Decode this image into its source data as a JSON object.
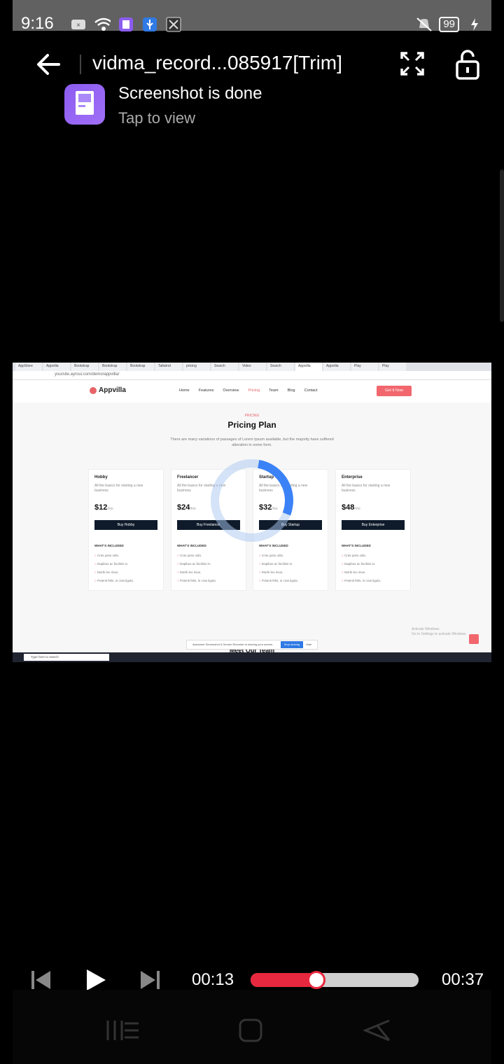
{
  "status_bar": {
    "time": "9:16",
    "battery": "99"
  },
  "title_bar": {
    "title": "vidma_record...085917[Trim]"
  },
  "toast": {
    "title": "Screenshot is done",
    "subtitle": "Tap to view"
  },
  "video_content": {
    "browser_tabs": [
      "AppStore",
      "Appvilla",
      "Bootstrap",
      "Bootstrap",
      "Bootstrap",
      "Tailwind",
      "pricing",
      "Search",
      "Video",
      "Search",
      "Appvilla",
      "Appvilla",
      "Play",
      "Play"
    ],
    "url": "yoursite.ayroui.com/demo/appvilla/",
    "logo": "Appvilla",
    "menu": [
      "Home",
      "Features",
      "Overview",
      "Pricing",
      "Team",
      "Blog",
      "Contact"
    ],
    "cta": "Get It Now",
    "section_tag": "PRICING",
    "section_title": "Pricing Plan",
    "section_desc": "There are many variations of passages of Lorem Ipsum available, but the majority have suffered alteration in some form.",
    "cards": [
      {
        "name": "Hobby",
        "desc": "All the basics for starting a new business",
        "price": "$12",
        "per": "/mo",
        "button": "Buy Hobby",
        "includes": "WHAT'S INCLUDED",
        "features": [
          "Cras justo odio.",
          "Dapibus ac facilisis in.",
          "Morbi leo risus.",
          "Potenti felis, in cras ligula."
        ]
      },
      {
        "name": "Freelancer",
        "desc": "All the basics for starting a new business",
        "price": "$24",
        "per": "/mo",
        "button": "Buy Freelancer",
        "includes": "WHAT'S INCLUDED",
        "features": [
          "Cras justo odio.",
          "Dapibus ac facilisis in.",
          "Morbi leo risus.",
          "Potenti felis, in cras ligula."
        ]
      },
      {
        "name": "Startup",
        "desc": "All the basics for starting a new business",
        "price": "$32",
        "per": "/mo",
        "button": "Buy Startup",
        "includes": "WHAT'S INCLUDED",
        "features": [
          "Cras justo odio.",
          "Dapibus ac facilisis in.",
          "Morbi leo risus.",
          "Potenti felis, in cras ligula."
        ]
      },
      {
        "name": "Enterprise",
        "desc": "All the basics for starting a new business",
        "price": "$48",
        "per": "/mo",
        "button": "Buy Enterprise",
        "includes": "WHAT'S INCLUDED",
        "features": [
          "Cras justo odio.",
          "Dapibus ac facilisis in.",
          "Morbi leo risus.",
          "Potenti felis, in cras ligula."
        ]
      }
    ],
    "share_text": "Awesome Screenshot & Screen Recorder is sharing your screen.",
    "stop_sharing": "Stop sharing",
    "hide": "Hide",
    "next_section": "Meet Our Team",
    "activate_windows": "Activate Windows",
    "activate_hint": "Go to Settings to activate Windows.",
    "taskbar_search": "Type here to search"
  },
  "player": {
    "current_time": "00:13",
    "total_time": "00:37",
    "progress": 0.39
  },
  "colors": {
    "accent": "#e8283e",
    "toast_icon": "#8c5cf0",
    "spinner": "#3b82f6"
  }
}
